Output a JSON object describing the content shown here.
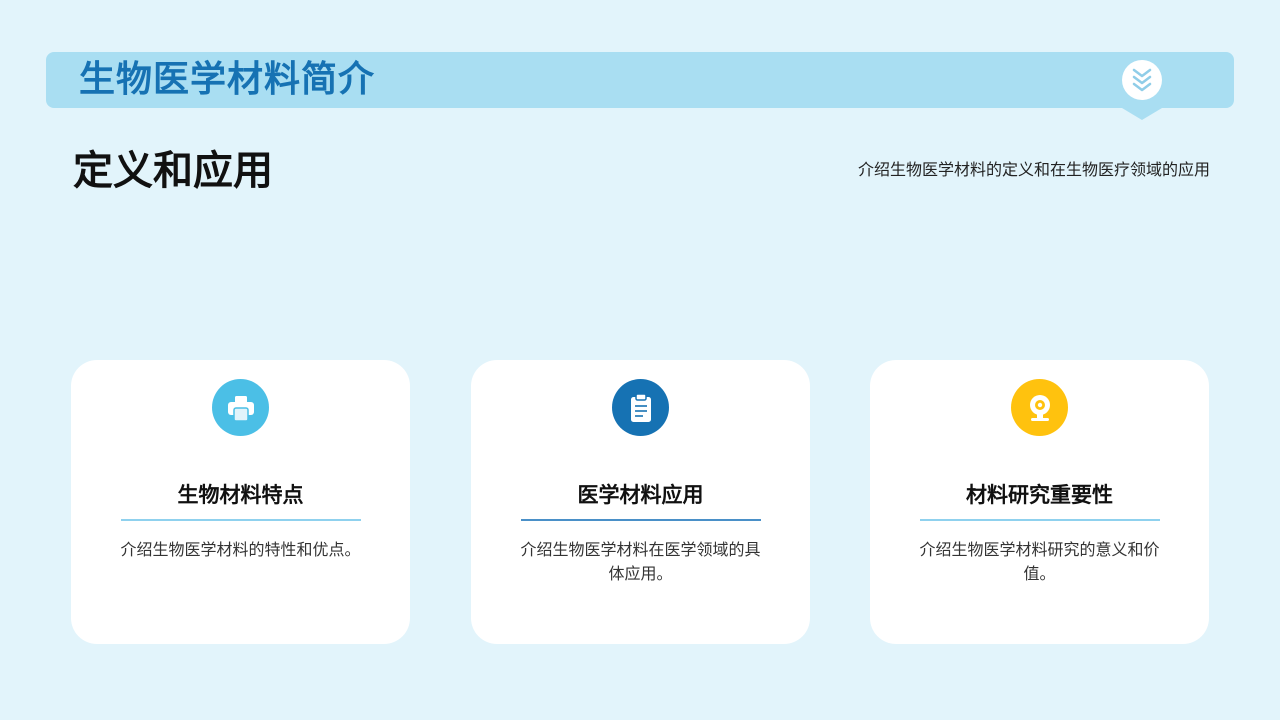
{
  "header": {
    "title": "生物医学材料简介",
    "badge_icon": "double-chevron-down-icon"
  },
  "section": {
    "title": "定义和应用",
    "description": "介绍生物医学材料的定义和在生物医疗领域的应用"
  },
  "cards": [
    {
      "title": "生物材料特点",
      "text": "介绍生物医学材料的特性和优点。",
      "icon": "printer-icon",
      "icon_color": "#4bbfe6",
      "rule_color": "#8fd1ee"
    },
    {
      "title": "医学材料应用",
      "text": "介绍生物医学材料在医学领域的具体应用。",
      "icon": "clipboard-icon",
      "icon_color": "#1672b3",
      "rule_color": "#4a90c8"
    },
    {
      "title": "材料研究重要性",
      "text": "介绍生物医学材料研究的意义和价值。",
      "icon": "webcam-icon",
      "icon_color": "#ffc20e",
      "rule_color": "#8fd1ee"
    }
  ]
}
